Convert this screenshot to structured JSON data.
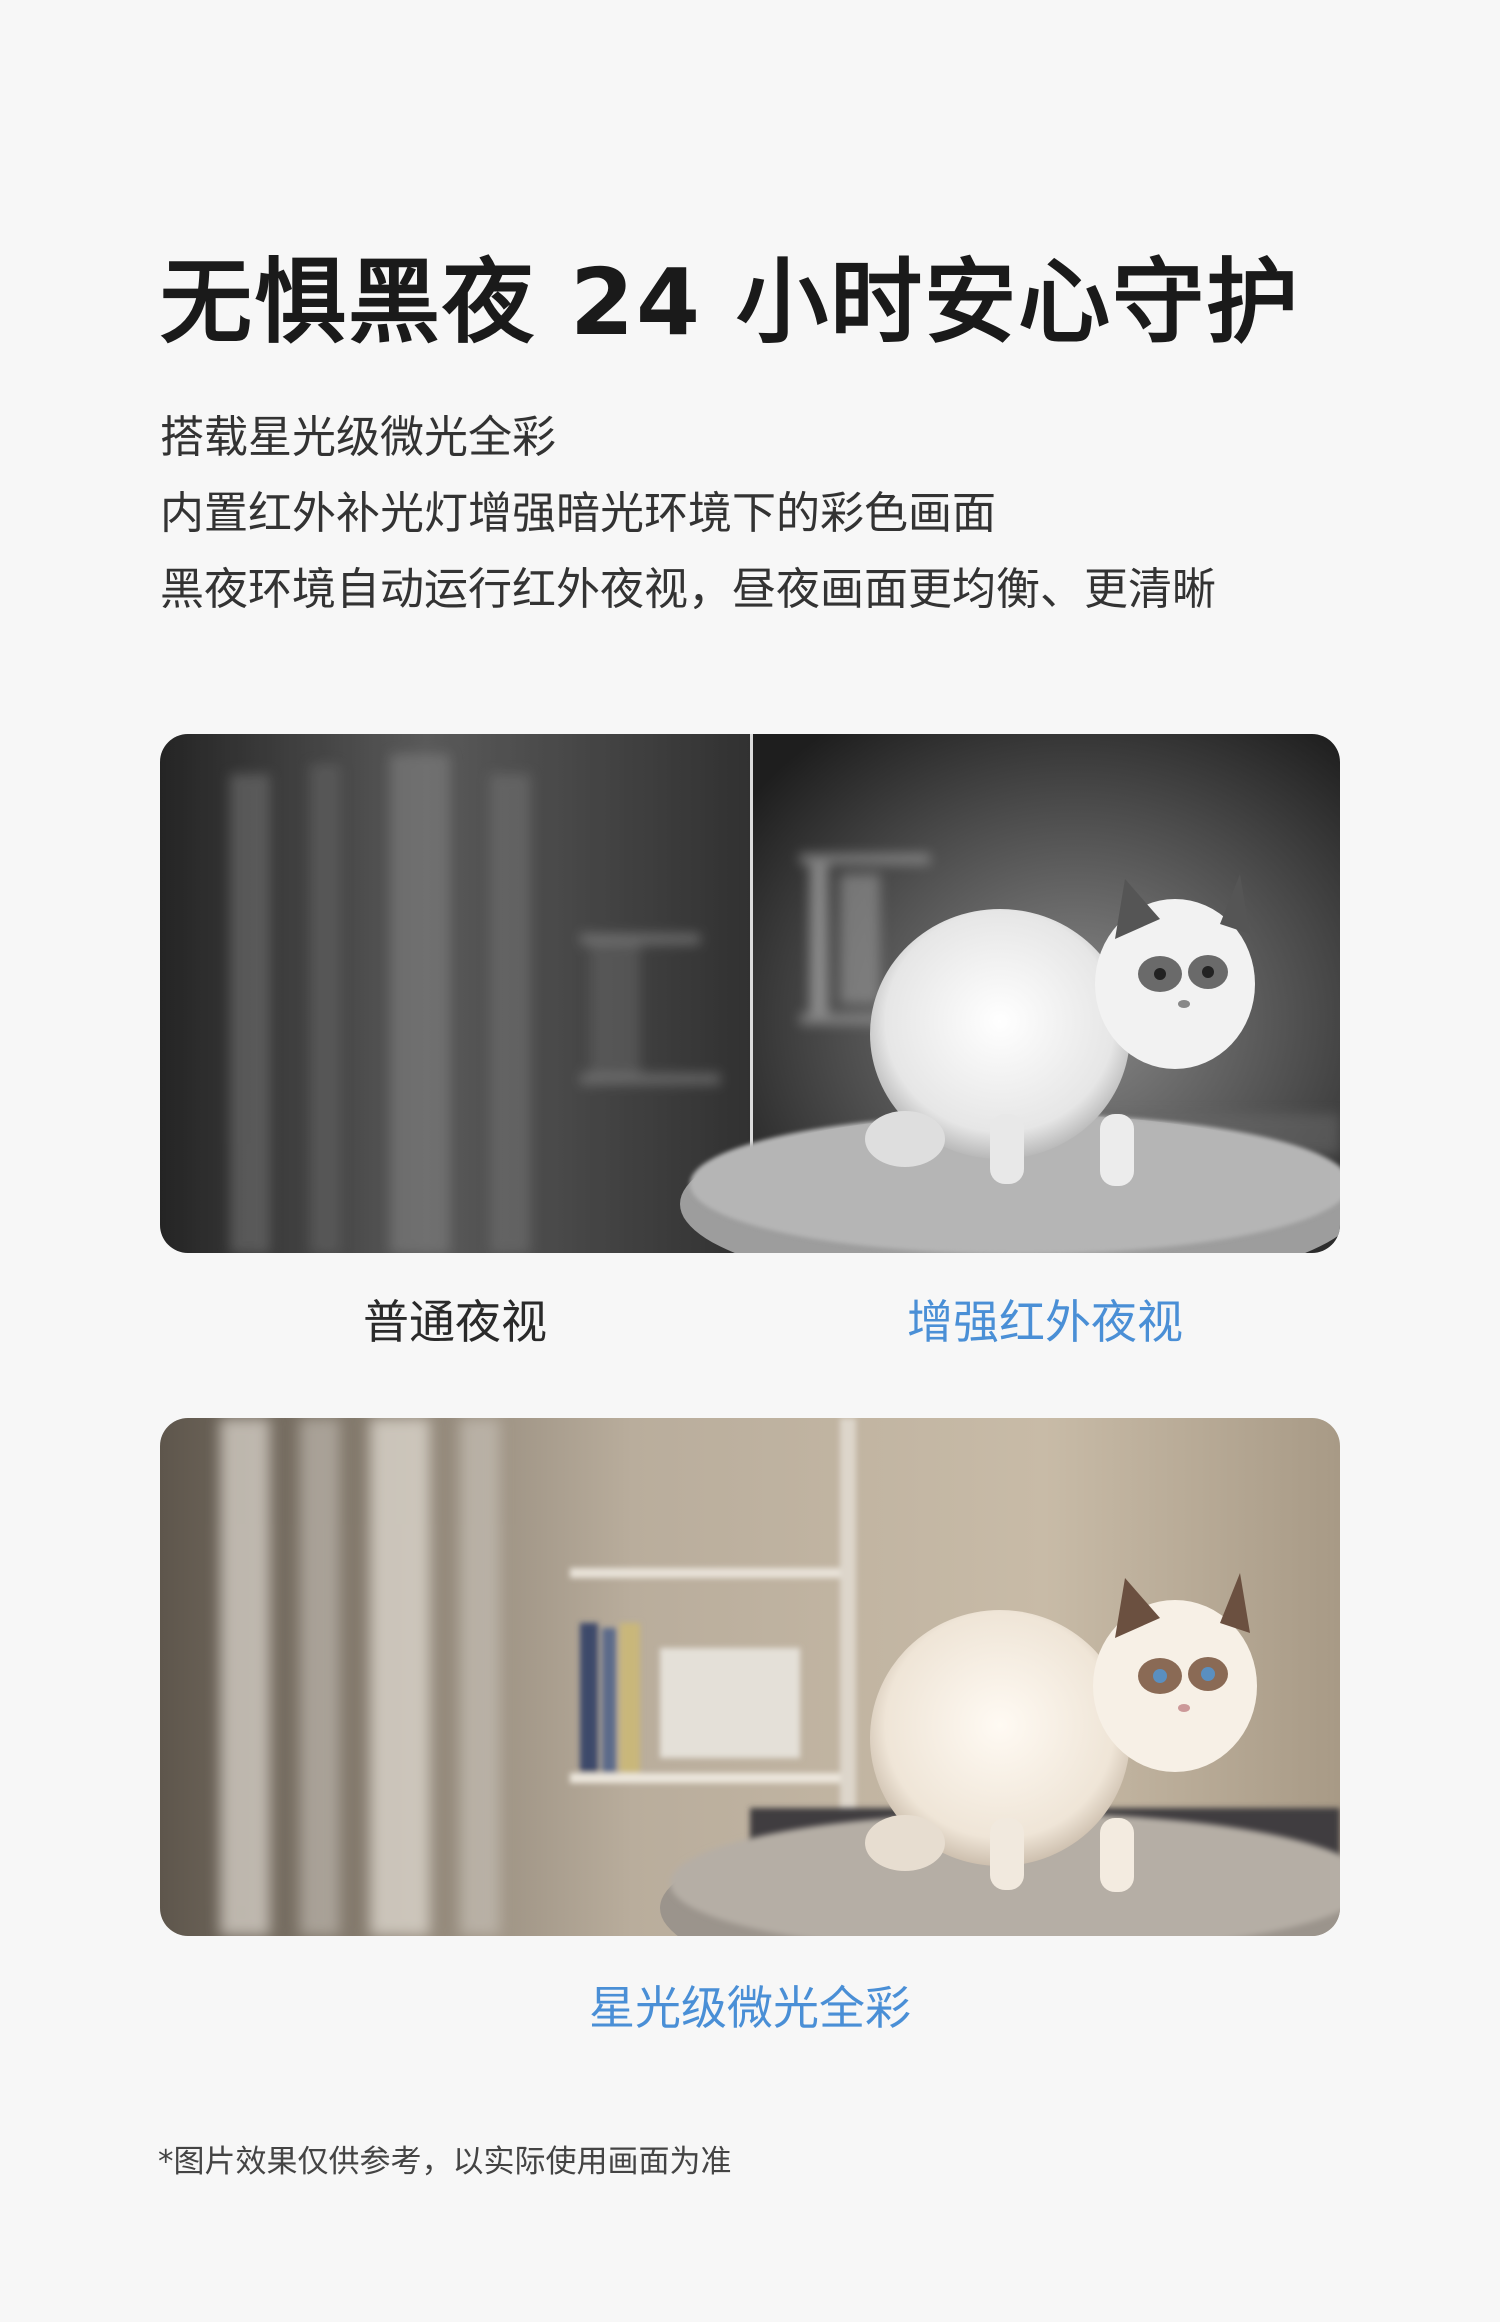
{
  "header": {
    "title": "无惧黑夜  24 小时安心守护",
    "lines": [
      "搭载星光级微光全彩",
      "内置红外补光灯增强暗光环境下的彩色画面",
      "黑夜环境自动运行红外夜视，昼夜画面更均衡、更清晰"
    ]
  },
  "comparison": {
    "left_caption": "普通夜视",
    "right_caption": "增强红外夜视"
  },
  "color_view": {
    "caption": "星光级微光全彩"
  },
  "footnote": "*图片效果仅供参考，以实际使用画面为准",
  "colors": {
    "accent": "#4a8fd6",
    "text": "#222222",
    "background": "#f7f7f7"
  }
}
